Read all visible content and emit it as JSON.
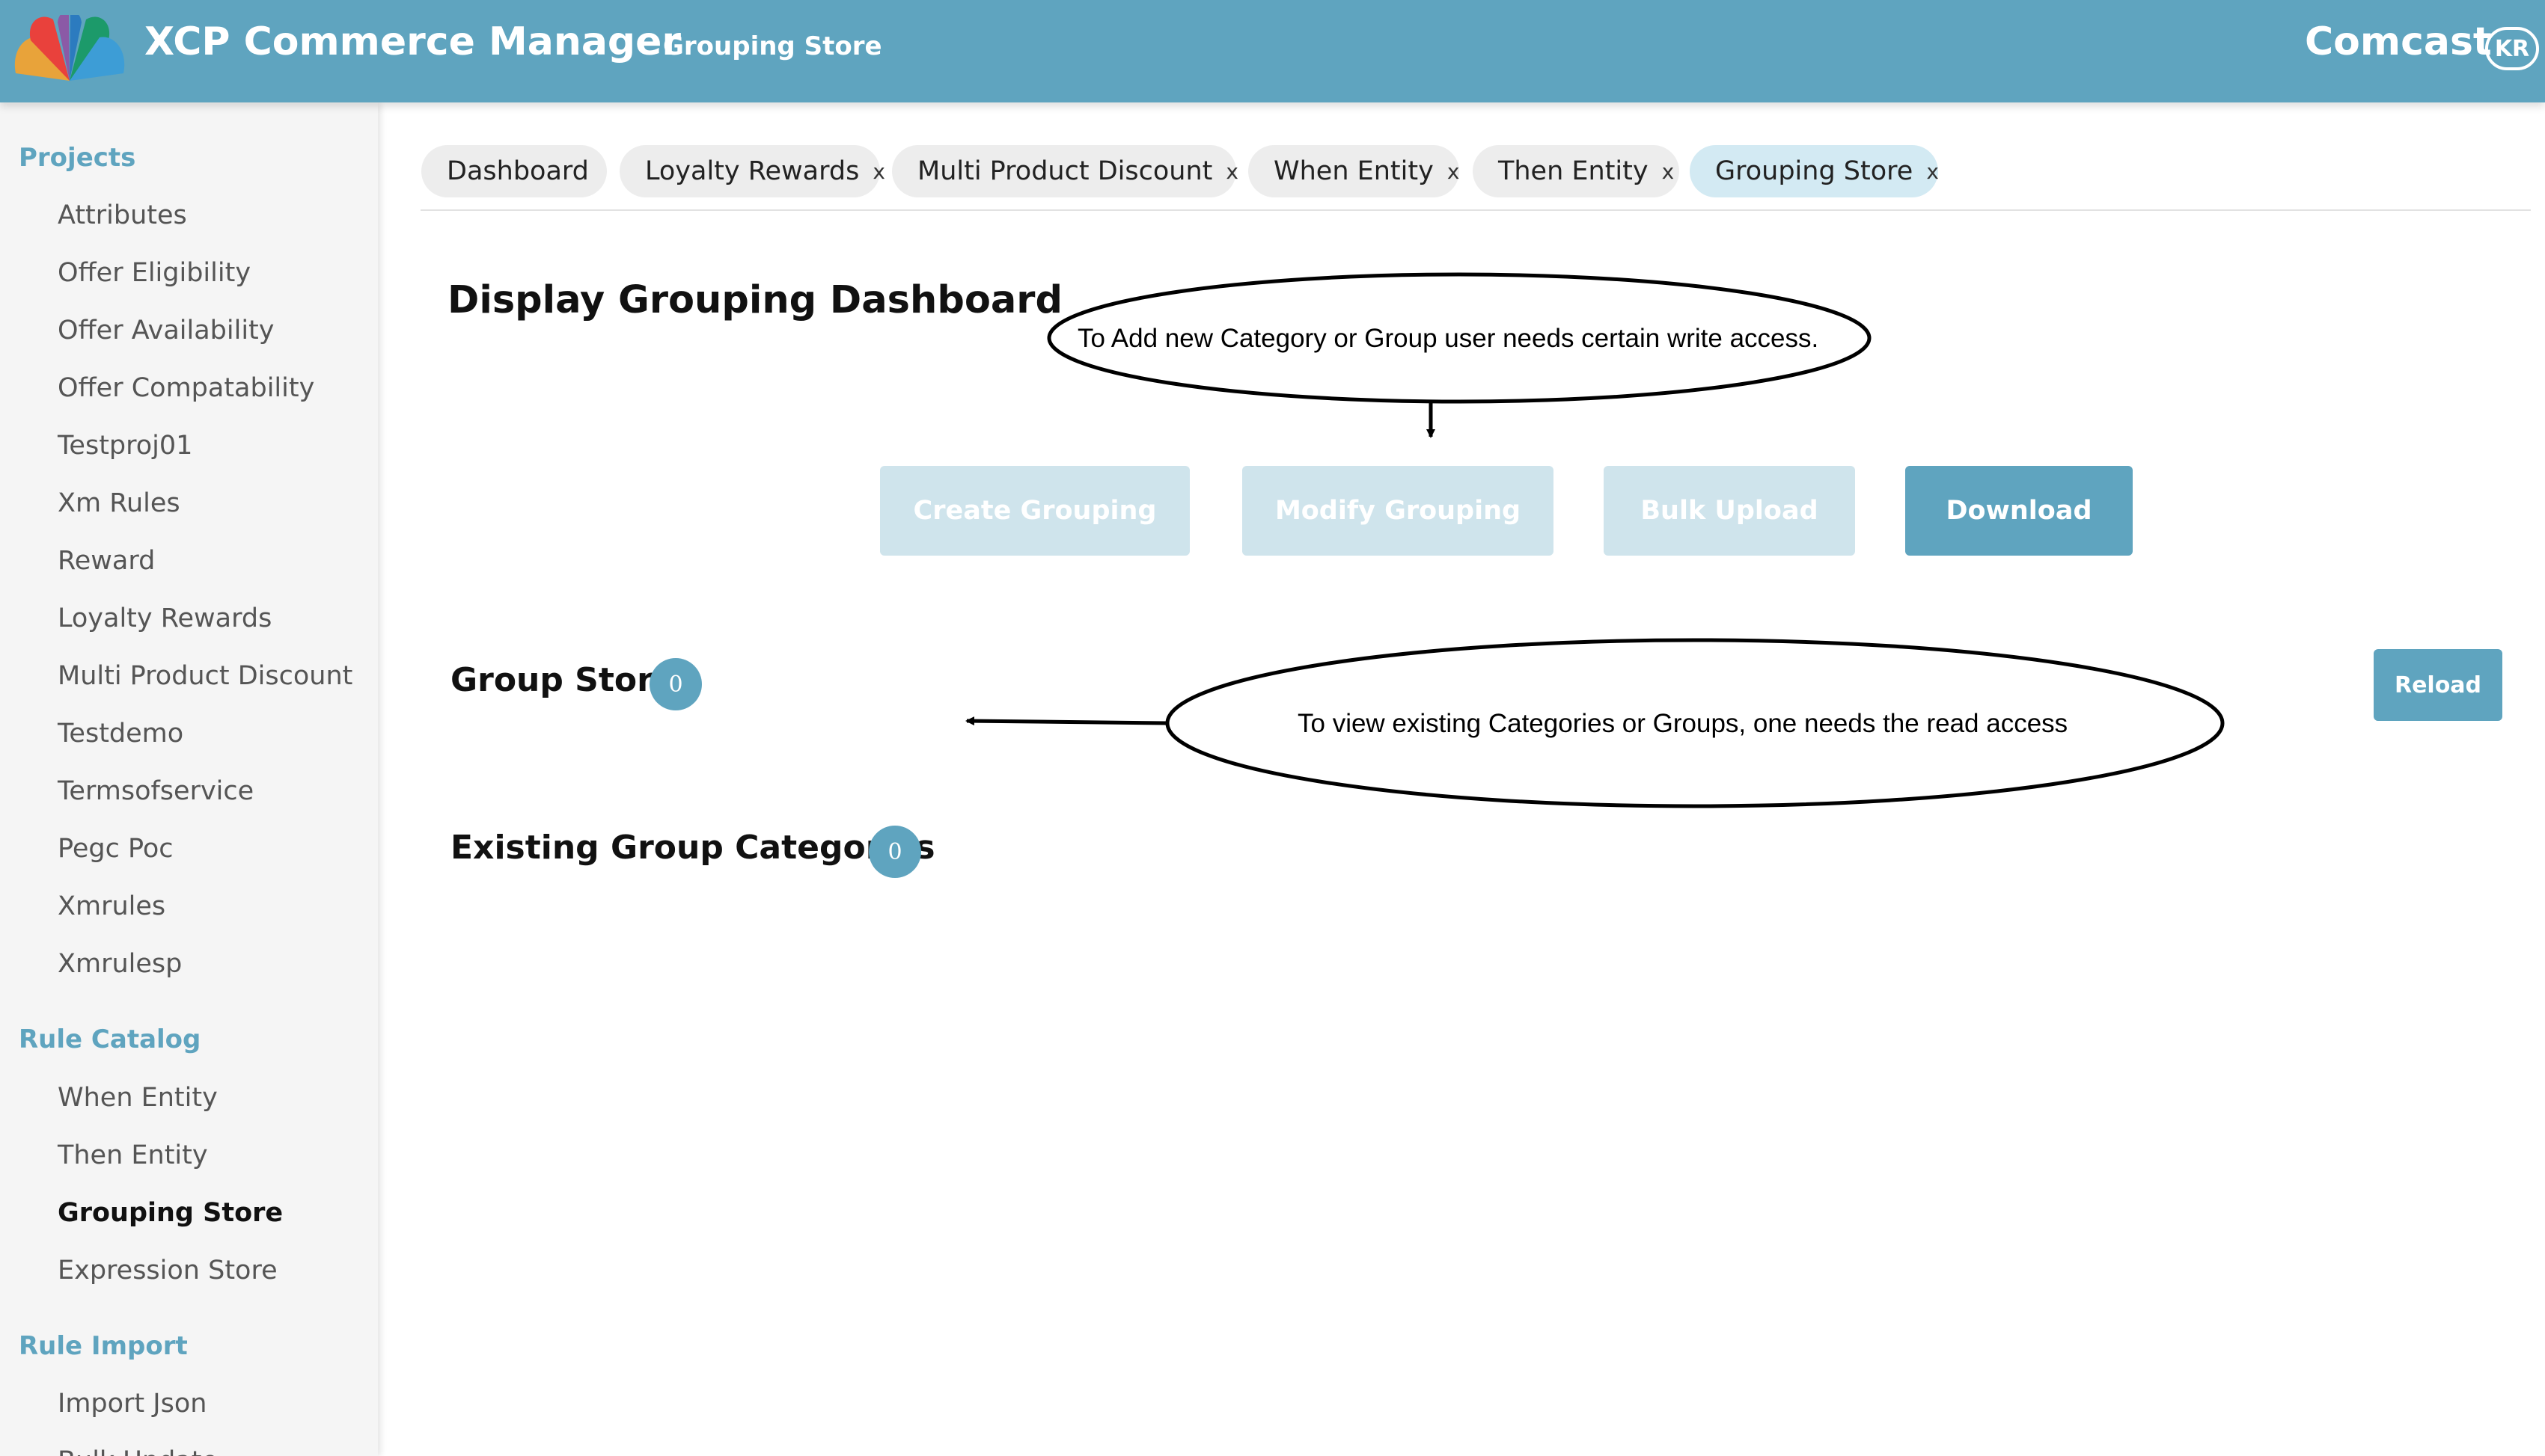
{
  "header": {
    "app_title": "XCP Commerce Manager",
    "page_name": "Grouping Store",
    "brand": "Comcast",
    "avatar_initials": "KR",
    "bg_color": "#5fa4bf"
  },
  "sidebar": {
    "sections": [
      {
        "title": "Projects",
        "items": [
          "Attributes",
          "Offer Eligibility",
          "Offer Availability",
          "Offer Compatability",
          "Testproj01",
          "Xm Rules",
          "Reward",
          "Loyalty Rewards",
          "Multi Product Discount",
          "Testdemo",
          "Termsofservice",
          "Pegc Poc",
          "Xmrules",
          "Xmrulesp"
        ]
      },
      {
        "title": "Rule Catalog",
        "items": [
          "When Entity",
          "Then Entity",
          "Grouping Store",
          "Expression Store"
        ]
      },
      {
        "title": "Rule Import",
        "items": [
          "Import Json",
          "Bulk Update"
        ]
      }
    ],
    "active_item": "Grouping Store"
  },
  "tabs": [
    {
      "label": "Dashboard",
      "closable": false
    },
    {
      "label": "Loyalty Rewards",
      "closable": true
    },
    {
      "label": "Multi Product Discount",
      "closable": true
    },
    {
      "label": "When Entity",
      "closable": true
    },
    {
      "label": "Then Entity",
      "closable": true
    },
    {
      "label": "Grouping Store",
      "closable": true,
      "active": true
    }
  ],
  "tab_close_glyph": "x",
  "main": {
    "title": "Display Grouping Dashboard",
    "actions": {
      "create": "Create Grouping",
      "modify": "Modify Grouping",
      "bulk_upload": "Bulk Upload",
      "download": "Download"
    },
    "group_store": {
      "label": "Group Store",
      "count": "0"
    },
    "existing_categories": {
      "label": "Existing Group Categories",
      "count": "0"
    },
    "reload": "Reload"
  },
  "annotations": {
    "write_access": "To Add new Category or Group user needs certain write access.",
    "read_access": "To view existing Categories or Groups, one needs the read access"
  }
}
